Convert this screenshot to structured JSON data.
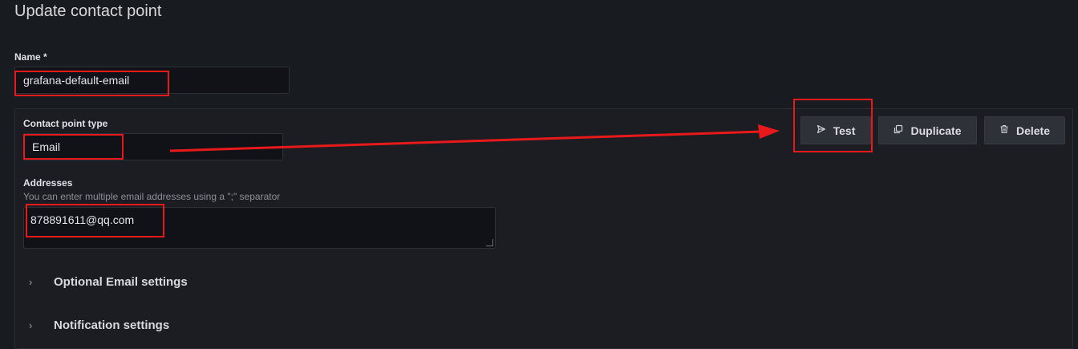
{
  "page": {
    "title": "Update contact point"
  },
  "name_field": {
    "label": "Name *",
    "value": "grafana-default-email"
  },
  "contact_point_type": {
    "label": "Contact point type",
    "value": "Email"
  },
  "addresses": {
    "label": "Addresses",
    "help": "You can enter multiple email addresses using a \";\" separator",
    "value": "878891611@qq.com"
  },
  "sections": {
    "optional": "Optional Email settings",
    "notification": "Notification settings"
  },
  "actions": {
    "test_label": "Test",
    "duplicate_label": "Duplicate",
    "delete_label": "Delete"
  },
  "icons": {
    "test": "send-icon",
    "duplicate": "copy-icon",
    "delete": "trash-icon",
    "select": "chevron-down-icon",
    "section": "chevron-right-icon"
  },
  "colors": {
    "background": "#181b1f",
    "input_bg": "#111217",
    "button_bg": "#2f3138",
    "annotation": "#e8191b"
  }
}
